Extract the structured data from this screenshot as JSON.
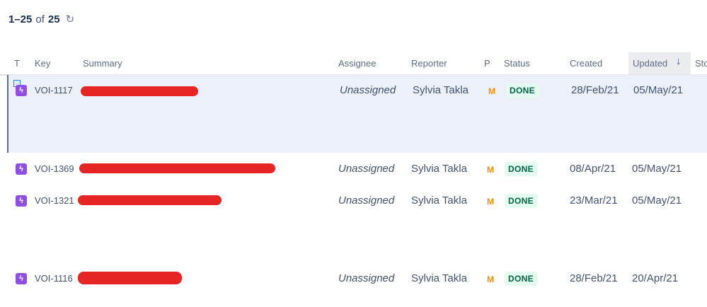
{
  "pager": {
    "range": "1–25",
    "of": "of",
    "total": "25",
    "refresh_icon": "refresh-icon"
  },
  "columns": {
    "type": "T",
    "key": "Key",
    "summary": "Summary",
    "assignee": "Assignee",
    "reporter": "Reporter",
    "priority": "P",
    "status": "Status",
    "created": "Created",
    "updated": "Updated",
    "updated_sort_icon": "↓",
    "story": "Sto"
  },
  "rows": [
    {
      "type_icon": "epic-icon",
      "key": "VOI-1117",
      "assignee": "Unassigned",
      "reporter": "Sylvia Takla",
      "priority": "M",
      "status": "DONE",
      "created": "28/Feb/21",
      "updated": "05/May/21"
    },
    {
      "type_icon": "epic-icon",
      "key": "VOI-1369",
      "assignee": "Unassigned",
      "reporter": "Sylvia Takla",
      "priority": "M",
      "status": "DONE",
      "created": "08/Apr/21",
      "updated": "05/May/21"
    },
    {
      "type_icon": "epic-icon",
      "key": "VOI-1321",
      "assignee": "Unassigned",
      "reporter": "Sylvia Takla",
      "priority": "M",
      "status": "DONE",
      "created": "23/Mar/21",
      "updated": "05/May/21"
    },
    {
      "type_icon": "epic-icon",
      "key": "VOI-1116",
      "assignee": "Unassigned",
      "reporter": "Sylvia Takla",
      "priority": "M",
      "status": "DONE",
      "created": "28/Feb/21",
      "updated": "20/Apr/21"
    }
  ],
  "colors": {
    "epic": "#904ee2",
    "done_bg": "#e3fcef",
    "done_text": "#006644",
    "priority_medium": "#ff8b00",
    "selected_row": "#ebf0f9",
    "redaction": "#e62424"
  }
}
